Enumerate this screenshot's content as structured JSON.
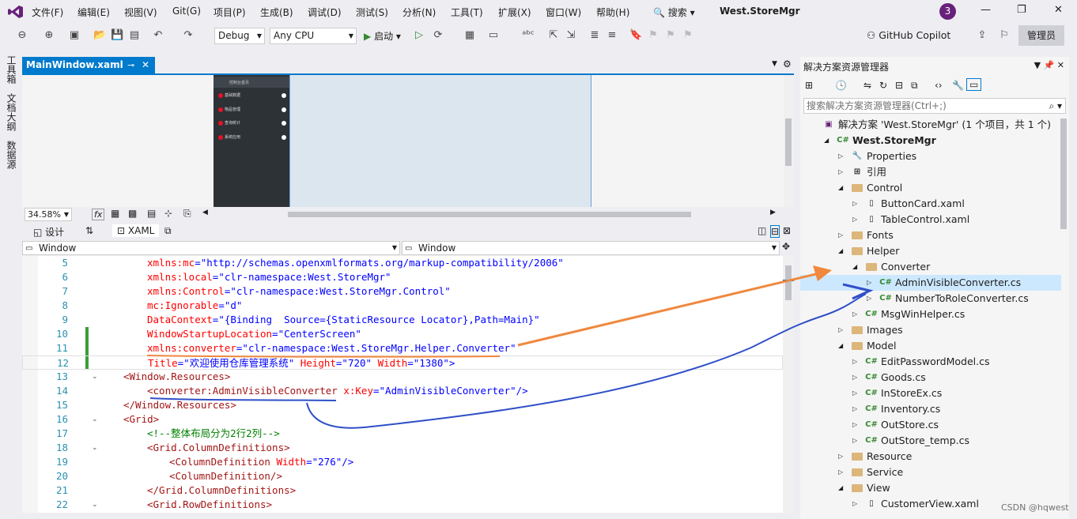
{
  "menubar": {
    "items": [
      "文件(F)",
      "编辑(E)",
      "视图(V)",
      "Git(G)",
      "项目(P)",
      "生成(B)",
      "调试(D)",
      "测试(S)",
      "分析(N)",
      "工具(T)",
      "扩展(X)",
      "窗口(W)",
      "帮助(H)"
    ],
    "search": "搜索",
    "app_title": "West.StoreMgr",
    "avatar": "3"
  },
  "toolbar": {
    "config": "Debug",
    "platform": "Any CPU",
    "start": "启动",
    "copilot": "GitHub Copilot",
    "admin": "管理员"
  },
  "left_tabs": [
    "工具箱",
    "文档大纲",
    "数据源"
  ],
  "doc_tab": {
    "title": "MainWindow.xaml"
  },
  "designer": {
    "header": "控制台首页",
    "items": [
      "基础数据",
      "物品管理",
      "查询统计",
      "系统应用"
    ],
    "zoom": "34.58%"
  },
  "split": {
    "design": "设计",
    "xaml": "XAML"
  },
  "nav": {
    "left": "Window",
    "right": "Window"
  },
  "code_lines": [
    {
      "n": "5",
      "segs": [
        {
          "t": "xmlns:mc",
          "c": "a"
        },
        {
          "t": "=\"http://schemas.openxmlformats.org/markup-compatibility/2006\"",
          "c": "v"
        }
      ]
    },
    {
      "n": "6",
      "segs": [
        {
          "t": "xmlns:local",
          "c": "a"
        },
        {
          "t": "=\"clr-namespace:West.StoreMgr\"",
          "c": "v"
        }
      ]
    },
    {
      "n": "7",
      "segs": [
        {
          "t": "xmlns:Control",
          "c": "a"
        },
        {
          "t": "=\"clr-namespace:West.StoreMgr.Control\"",
          "c": "v"
        }
      ]
    },
    {
      "n": "8",
      "segs": [
        {
          "t": "mc:Ignorable",
          "c": "a"
        },
        {
          "t": "=\"d\"",
          "c": "v"
        }
      ]
    },
    {
      "n": "9",
      "segs": [
        {
          "t": "DataContext",
          "c": "a"
        },
        {
          "t": "=\"{Binding  Source={StaticResource Locator},Path=Main}\"",
          "c": "v"
        }
      ]
    },
    {
      "n": "10",
      "segs": [
        {
          "t": "WindowStartupLocation",
          "c": "a"
        },
        {
          "t": "=\"CenterScreen\"",
          "c": "v"
        }
      ]
    },
    {
      "n": "11",
      "segs": [
        {
          "t": "xmlns:converter",
          "c": "a"
        },
        {
          "t": "=\"clr-namespace:West.StoreMgr.Helper.Converter\"",
          "c": "v"
        }
      ]
    },
    {
      "n": "12",
      "segs": [
        {
          "t": "Title",
          "c": "a"
        },
        {
          "t": "=\"欢迎使用仓库管理系统\" ",
          "c": "v"
        },
        {
          "t": "Height",
          "c": "a"
        },
        {
          "t": "=\"720\" ",
          "c": "v"
        },
        {
          "t": "Width",
          "c": "a"
        },
        {
          "t": "=\"1380\">",
          "c": "v"
        }
      ]
    },
    {
      "n": "13",
      "segs": [
        {
          "t": "<Window.Resources>",
          "c": "t"
        }
      ]
    },
    {
      "n": "14",
      "segs": [
        {
          "t": "<converter:AdminVisibleConverter ",
          "c": "t"
        },
        {
          "t": "x:Key",
          "c": "a"
        },
        {
          "t": "=\"AdminVisibleConverter\"/>",
          "c": "v"
        }
      ]
    },
    {
      "n": "15",
      "segs": [
        {
          "t": "</Window.Resources>",
          "c": "t"
        }
      ]
    },
    {
      "n": "16",
      "segs": [
        {
          "t": "<Grid>",
          "c": "t"
        }
      ]
    },
    {
      "n": "17",
      "segs": [
        {
          "t": "<!--整体布局分为2行2列-->",
          "c": "c"
        }
      ]
    },
    {
      "n": "18",
      "segs": [
        {
          "t": "<Grid.ColumnDefinitions>",
          "c": "t"
        }
      ]
    },
    {
      "n": "19",
      "segs": [
        {
          "t": "<ColumnDefinition ",
          "c": "t"
        },
        {
          "t": "Width",
          "c": "a"
        },
        {
          "t": "=\"276\"/>",
          "c": "v"
        }
      ]
    },
    {
      "n": "20",
      "segs": [
        {
          "t": "<ColumnDefinition/>",
          "c": "t"
        }
      ]
    },
    {
      "n": "21",
      "segs": [
        {
          "t": "</Grid.ColumnDefinitions>",
          "c": "t"
        }
      ]
    },
    {
      "n": "22",
      "segs": [
        {
          "t": "<Grid.RowDefinitions>",
          "c": "t"
        }
      ]
    }
  ],
  "solution": {
    "title": "解决方案资源管理器",
    "search_placeholder": "搜索解决方案资源管理器(Ctrl+;)",
    "nodes": [
      {
        "label": "解决方案 'West.StoreMgr' (1 个项目，共 1 个)",
        "icon": "solution-icon",
        "level": 0,
        "exp": ""
      },
      {
        "label": "West.StoreMgr",
        "icon": "csproj-icon",
        "level": 1,
        "exp": "◢",
        "bold": true
      },
      {
        "label": "Properties",
        "icon": "wrench-icon",
        "level": 2,
        "exp": "▷"
      },
      {
        "label": "引用",
        "icon": "references-icon",
        "level": 2,
        "exp": "▷"
      },
      {
        "label": "Control",
        "icon": "folder-icon",
        "level": 2,
        "exp": "◢"
      },
      {
        "label": "ButtonCard.xaml",
        "icon": "xaml-file-icon",
        "level": 3,
        "exp": "▷"
      },
      {
        "label": "TableControl.xaml",
        "icon": "xaml-file-icon",
        "level": 3,
        "exp": "▷"
      },
      {
        "label": "Fonts",
        "icon": "folder-icon",
        "level": 2,
        "exp": "▷"
      },
      {
        "label": "Helper",
        "icon": "folder-icon",
        "level": 2,
        "exp": "◢"
      },
      {
        "label": "Converter",
        "icon": "folder-icon",
        "level": 3,
        "exp": "◢"
      },
      {
        "label": "AdminVisibleConverter.cs",
        "icon": "csharp-file-icon",
        "level": 4,
        "exp": "▷",
        "selected": true
      },
      {
        "label": "NumberToRoleConverter.cs",
        "icon": "csharp-file-icon",
        "level": 4,
        "exp": "▷"
      },
      {
        "label": "MsgWinHelper.cs",
        "icon": "csharp-file-icon",
        "level": 3,
        "exp": "▷"
      },
      {
        "label": "Images",
        "icon": "folder-icon",
        "level": 2,
        "exp": "▷"
      },
      {
        "label": "Model",
        "icon": "folder-icon",
        "level": 2,
        "exp": "◢"
      },
      {
        "label": "EditPasswordModel.cs",
        "icon": "csharp-file-icon",
        "level": 3,
        "exp": "▷"
      },
      {
        "label": "Goods.cs",
        "icon": "csharp-file-icon",
        "level": 3,
        "exp": "▷"
      },
      {
        "label": "InStoreEx.cs",
        "icon": "csharp-file-icon",
        "level": 3,
        "exp": "▷"
      },
      {
        "label": "Inventory.cs",
        "icon": "csharp-file-icon",
        "level": 3,
        "exp": "▷"
      },
      {
        "label": "OutStore.cs",
        "icon": "csharp-file-icon",
        "level": 3,
        "exp": "▷"
      },
      {
        "label": "OutStore_temp.cs",
        "icon": "csharp-file-icon",
        "level": 3,
        "exp": "▷"
      },
      {
        "label": "Resource",
        "icon": "folder-icon",
        "level": 2,
        "exp": "▷"
      },
      {
        "label": "Service",
        "icon": "folder-icon",
        "level": 2,
        "exp": "▷"
      },
      {
        "label": "View",
        "icon": "folder-icon",
        "level": 2,
        "exp": "◢"
      },
      {
        "label": "CustomerView.xaml",
        "icon": "xaml-file-icon",
        "level": 3,
        "exp": "▷"
      }
    ]
  },
  "watermark": "CSDN @hqwest",
  "colors": {
    "accent": "#007acc",
    "annotation_orange": "#f0883e",
    "annotation_blue": "#2f4fc8"
  }
}
